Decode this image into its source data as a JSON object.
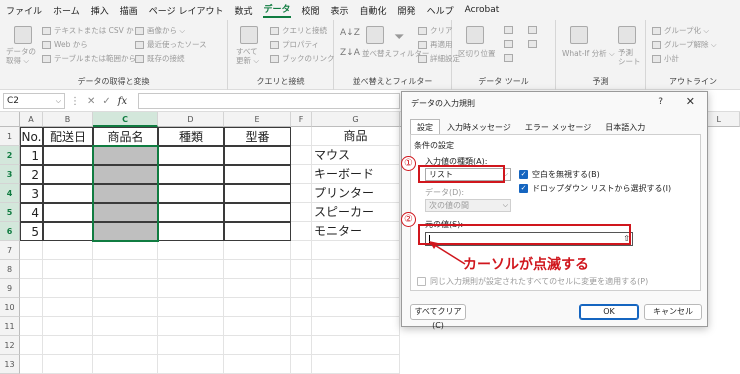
{
  "menubar": {
    "tabs": [
      "ファイル",
      "ホーム",
      "挿入",
      "描画",
      "ページ レイアウト",
      "数式",
      "データ",
      "校閲",
      "表示",
      "自動化",
      "開発",
      "ヘルプ",
      "Acrobat"
    ],
    "active_index": 6
  },
  "ribbon": {
    "group_get_data": {
      "label": "データの取得と変換",
      "big_button": "データの\n取得 ⌵",
      "items": [
        "テキストまたは CSV から",
        "Web から",
        "テーブルまたは範囲から",
        "最近使ったソース",
        "既存の接続",
        "画像から ⌵"
      ]
    },
    "group_queries": {
      "label": "クエリと接続",
      "big_button": "すべて\n更新 ⌵",
      "items": [
        "クエリと接続",
        "プロパティ",
        "ブックのリンク"
      ]
    },
    "group_sort": {
      "label": "並べ替えとフィルター",
      "items": [
        "並べ替え",
        "フィルター",
        "クリア",
        "再適用",
        "詳細設定"
      ]
    },
    "group_tools": {
      "label": "データ ツール",
      "items": [
        "区切り位置"
      ]
    },
    "group_forecast": {
      "label": "予測",
      "items": [
        "What-If 分析 ⌵",
        "予測\nシート"
      ]
    },
    "group_outline": {
      "label": "アウトライン",
      "items": [
        "グループ化 ⌵",
        "グループ解除 ⌵",
        "小計"
      ]
    }
  },
  "formula_bar": {
    "name_box": "C2",
    "fx_label": "fx",
    "value": ""
  },
  "sheet": {
    "columns": [
      "A",
      "B",
      "C",
      "D",
      "E",
      "F",
      "G"
    ],
    "extra_columns": [
      "L"
    ],
    "rows": [
      "1",
      "2",
      "3",
      "4",
      "5",
      "6",
      "7",
      "8",
      "9",
      "10",
      "11",
      "12",
      "13"
    ],
    "headers": [
      "No.",
      "配送日",
      "商品名",
      "種類",
      "型番"
    ],
    "numbers": [
      "1",
      "2",
      "3",
      "4",
      "5"
    ],
    "products_header": "商品",
    "products": [
      "マウス",
      "キーボード",
      "プリンター",
      "スピーカー",
      "モニター"
    ]
  },
  "dialog": {
    "title": "データの入力規則",
    "help": "?",
    "close": "✕",
    "tabs": [
      "設定",
      "入力時メッセージ",
      "エラー メッセージ",
      "日本語入力"
    ],
    "section": "条件の設定",
    "allow_label": "入力値の種類(A):",
    "allow_value": "リスト",
    "ignore_blank": "空白を無視する(B)",
    "dropdown": "ドロップダウン リストから選択する(I)",
    "data_label": "データ(D):",
    "data_value": "次の値の間",
    "source_label": "元の値(S):",
    "source_value": "",
    "apply_all": "同じ入力規則が設定されたすべてのセルに変更を適用する(P)",
    "clear_all": "すべてクリア(C)",
    "ok": "OK",
    "cancel": "キャンセル"
  },
  "annotations": {
    "circle1": "①",
    "circle2": "②",
    "caption": "カーソルが点滅する",
    "color": "#d0161d"
  }
}
